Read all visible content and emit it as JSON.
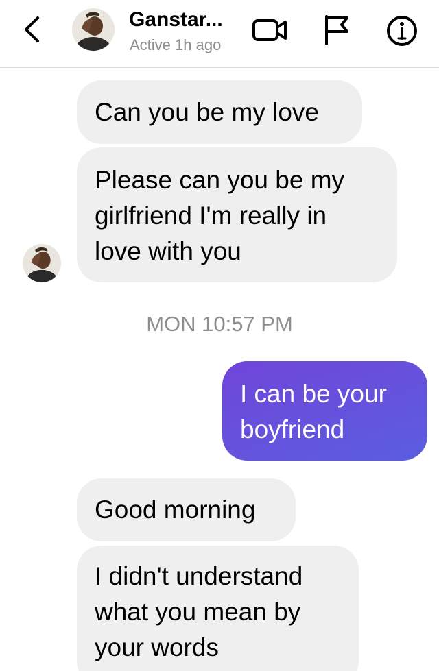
{
  "header": {
    "back_icon": "chevron-left-icon",
    "contact_name": "Ganstar...",
    "status": "Active 1h ago",
    "video_icon": "video-camera-icon",
    "flag_icon": "flag-icon",
    "info_icon": "info-icon"
  },
  "colors": {
    "incoming_bubble": "#efefef",
    "outgoing_gradient_start": "#7045d9",
    "outgoing_gradient_end": "#5b5ee0",
    "secondary_text": "#8e8e8e",
    "divider": "#dbdbdb"
  },
  "messages": [
    {
      "direction": "incoming",
      "text": "Can you be my love"
    },
    {
      "direction": "incoming",
      "text": "Please can you be my girlfriend I'm really in love with you"
    },
    {
      "direction": "outgoing",
      "text": "I can be your boyfriend"
    },
    {
      "direction": "incoming",
      "text": "Good morning"
    },
    {
      "direction": "incoming",
      "text": "I didn't understand what you mean by your words"
    }
  ],
  "timestamp": "MON 10:57 PM"
}
